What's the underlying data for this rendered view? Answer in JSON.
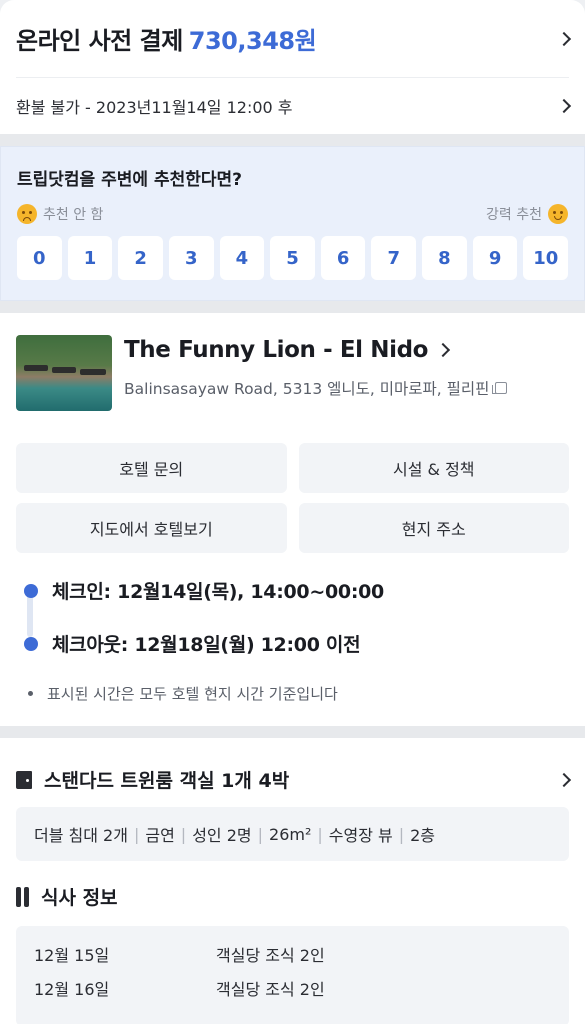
{
  "payment": {
    "label": "온라인 사전 결제",
    "amount": "730,348원",
    "refund": "환불 불가 - 2023년11월14일 12:00 후"
  },
  "survey": {
    "question": "트립닷컴을 주변에 추천한다면?",
    "low_label": "추천 안 함",
    "high_label": "강력 추천",
    "scores": [
      "0",
      "1",
      "2",
      "3",
      "4",
      "5",
      "6",
      "7",
      "8",
      "9",
      "10"
    ]
  },
  "hotel": {
    "name": "The Funny Lion - El Nido",
    "address": "Balinsasayaw Road, 5313 엘니도, 미마로파, 필리핀",
    "buttons": [
      "호텔 문의",
      "시설 & 정책",
      "지도에서 호텔보기",
      "현지 주소"
    ],
    "checkin": "체크인: 12월14일(목), 14:00~00:00",
    "checkout": "체크아웃: 12월18일(월) 12:00 이전",
    "time_note": "표시된 시간은 모두 호텔 현지 시간 기준입니다"
  },
  "room": {
    "title": "스탠다드 트윈룸  객실 1개 4박",
    "features": [
      "더블 침대 2개",
      "금연",
      "성인 2명",
      "26m²",
      "수영장 뷰",
      "2층"
    ]
  },
  "meal": {
    "title": "식사 정보",
    "rows": [
      {
        "date": "12월 15일",
        "desc": "객실당 조식 2인"
      },
      {
        "date": "12월 16일",
        "desc": "객실당 조식 2인"
      }
    ]
  },
  "icons": {
    "chevron": "chevron-right-icon",
    "copy": "copy-icon",
    "door": "door-icon",
    "cutlery": "cutlery-icon",
    "sad": "sad-face-icon",
    "happy": "happy-face-icon"
  },
  "colors": {
    "accent": "#3d6bd6",
    "survey_bg": "#eaf0fb"
  }
}
